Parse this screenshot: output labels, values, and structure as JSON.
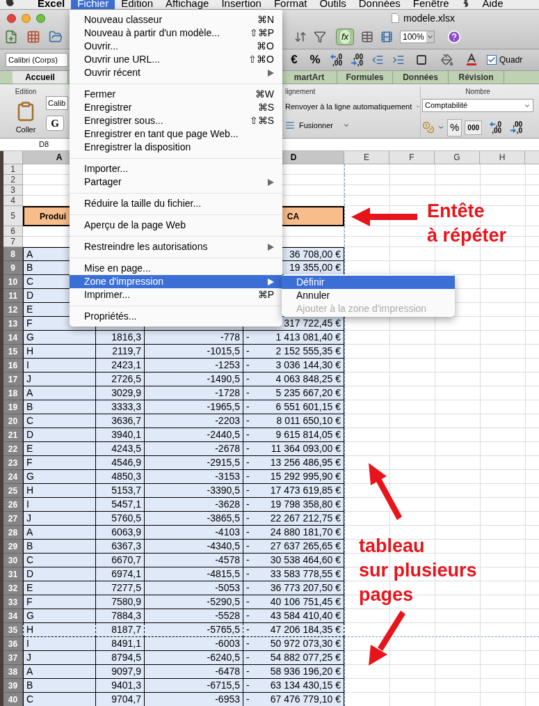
{
  "menu_bar": {
    "items": [
      {
        "kind": "app",
        "label": "Excel",
        "selected": false
      },
      {
        "kind": "menu",
        "label": "Fichier",
        "selected": true
      },
      {
        "kind": "menu",
        "label": "Edition",
        "selected": false
      },
      {
        "kind": "menu",
        "label": "Affichage",
        "selected": false
      },
      {
        "kind": "menu",
        "label": "Insertion",
        "selected": false
      },
      {
        "kind": "menu",
        "label": "Format",
        "selected": false
      },
      {
        "kind": "menu",
        "label": "Outils",
        "selected": false
      },
      {
        "kind": "menu",
        "label": "Données",
        "selected": false
      },
      {
        "kind": "menu",
        "label": "Fenêtre",
        "selected": false
      },
      {
        "kind": "script_icon",
        "selected": false
      },
      {
        "kind": "menu",
        "label": "Aide",
        "selected": false
      }
    ]
  },
  "window": {
    "title": "modele.xlsx"
  },
  "toolbar": {
    "function_label": "fx",
    "zoom": "100%"
  },
  "format_bar": {
    "font": "Calibri (Corps)",
    "buttons": [
      {
        "kind": "text",
        "label": "€"
      },
      {
        "kind": "text",
        "label": "%"
      },
      {
        "kind": "decimal",
        "top": ",0",
        "bottom": ",00"
      },
      {
        "kind": "decimal",
        "top": ",00",
        "bottom": ",0"
      }
    ],
    "checkbox": {
      "label": "Quadr",
      "checked": true
    }
  },
  "ribbon_tabs": [
    {
      "label": "Accueil",
      "selected": true
    },
    {
      "label": "martArt",
      "selected": false
    },
    {
      "label": "Formules",
      "selected": false
    },
    {
      "label": "Données",
      "selected": false
    },
    {
      "label": "Révision",
      "selected": false
    }
  ],
  "ribbon": {
    "edition": {
      "title": "Edition",
      "paste": "Coller"
    },
    "font": {
      "name": "Calib",
      "bold": "G"
    },
    "alignment": {
      "title": "lignement",
      "wrap": "Renvoyer à la ligne automatiquement",
      "merge": "Fusionner"
    },
    "number": {
      "title": "Nombre",
      "format": "Comptabilité",
      "percent": "%",
      "thousands": "000",
      "decimals": [
        {
          "top": ",0",
          "bottom": ",00"
        },
        {
          "top": ",00",
          "bottom": ",0"
        }
      ]
    }
  },
  "formula_bar": {
    "cell": "D8"
  },
  "columns": [
    {
      "label": "A",
      "selected": true
    },
    {
      "label": "D",
      "selected": true
    },
    {
      "label": "E",
      "selected": false
    },
    {
      "label": "F",
      "selected": false
    },
    {
      "label": "G",
      "selected": false
    },
    {
      "label": "H",
      "selected": false
    }
  ],
  "rows": [
    {
      "number": "1",
      "kind": "blank",
      "selected": false
    },
    {
      "number": "2",
      "kind": "blank",
      "selected": false
    },
    {
      "number": "3",
      "kind": "blank",
      "selected": false
    },
    {
      "number": "4",
      "kind": "blank",
      "selected": false
    },
    {
      "number": "5",
      "kind": "header",
      "selected": false,
      "a": "Produi",
      "d": "CA"
    },
    {
      "number": "6",
      "kind": "blank",
      "selected": false
    },
    {
      "number": "7",
      "kind": "blank",
      "selected": false
    },
    {
      "number": "8",
      "kind": "data",
      "selected": true,
      "a": "A",
      "d": "36 708,00 €"
    },
    {
      "number": "9",
      "kind": "data",
      "selected": true,
      "a": "B",
      "d": "19 355,00 €"
    },
    {
      "number": "10",
      "kind": "data",
      "selected": true,
      "a": "C"
    },
    {
      "number": "11",
      "kind": "data",
      "selected": true,
      "a": "D"
    },
    {
      "number": "12",
      "kind": "data",
      "selected": true,
      "a": "E"
    },
    {
      "number": "13",
      "kind": "data",
      "selected": true,
      "a": "F",
      "d": "317 722,45 €"
    },
    {
      "number": "14",
      "kind": "data",
      "selected": true,
      "a": "G",
      "b": "1816,3",
      "c": "-778",
      "d_prefix": "-",
      "d": "1 413 081,40 €"
    },
    {
      "number": "15",
      "kind": "data",
      "selected": true,
      "a": "H",
      "b": "2119,7",
      "c": "-1015,5",
      "d_prefix": "-",
      "d": "2 152 555,35 €"
    },
    {
      "number": "16",
      "kind": "data",
      "selected": true,
      "a": "I",
      "b": "2423,1",
      "c": "-1253",
      "d_prefix": "-",
      "d": "3 036 144,30 €"
    },
    {
      "number": "17",
      "kind": "data",
      "selected": true,
      "a": "J",
      "b": "2726,5",
      "c": "-1490,5",
      "d_prefix": "-",
      "d": "4 063 848,25 €"
    },
    {
      "number": "18",
      "kind": "data",
      "selected": true,
      "a": "A",
      "b": "3029,9",
      "c": "-1728",
      "d_prefix": "-",
      "d": "5 235 667,20 €"
    },
    {
      "number": "19",
      "kind": "data",
      "selected": true,
      "a": "B",
      "b": "3333,3",
      "c": "-1965,5",
      "d_prefix": "-",
      "d": "6 551 601,15 €"
    },
    {
      "number": "20",
      "kind": "data",
      "selected": true,
      "a": "C",
      "b": "3636,7",
      "c": "-2203",
      "d_prefix": "-",
      "d": "8 011 650,10 €"
    },
    {
      "number": "21",
      "kind": "data",
      "selected": true,
      "a": "D",
      "b": "3940,1",
      "c": "-2440,5",
      "d_prefix": "-",
      "d": "9 615 814,05 €"
    },
    {
      "number": "22",
      "kind": "data",
      "selected": true,
      "a": "E",
      "b": "4243,5",
      "c": "-2678",
      "d_prefix": "-",
      "d": "11 364 093,00 €"
    },
    {
      "number": "23",
      "kind": "data",
      "selected": true,
      "a": "F",
      "b": "4546,9",
      "c": "-2915,5",
      "d_prefix": "-",
      "d": "13 256 486,95 €"
    },
    {
      "number": "24",
      "kind": "data",
      "selected": true,
      "a": "G",
      "b": "4850,3",
      "c": "-3153",
      "d_prefix": "-",
      "d": "15 292 995,90 €"
    },
    {
      "number": "25",
      "kind": "data",
      "selected": true,
      "a": "H",
      "b": "5153,7",
      "c": "-3390,5",
      "d_prefix": "-",
      "d": "17 473 619,85 €"
    },
    {
      "number": "26",
      "kind": "data",
      "selected": true,
      "a": "I",
      "b": "5457,1",
      "c": "-3628",
      "d_prefix": "-",
      "d": "19 798 358,80 €"
    },
    {
      "number": "27",
      "kind": "data",
      "selected": true,
      "a": "J",
      "b": "5760,5",
      "c": "-3865,5",
      "d_prefix": "-",
      "d": "22 267 212,75 €"
    },
    {
      "number": "28",
      "kind": "data",
      "selected": true,
      "a": "A",
      "b": "6063,9",
      "c": "-4103",
      "d_prefix": "-",
      "d": "24 880 181,70 €"
    },
    {
      "number": "29",
      "kind": "data",
      "selected": true,
      "a": "B",
      "b": "6367,3",
      "c": "-4340,5",
      "d_prefix": "-",
      "d": "27 637 265,65 €"
    },
    {
      "number": "30",
      "kind": "data",
      "selected": true,
      "a": "C",
      "b": "6670,7",
      "c": "-4578",
      "d_prefix": "-",
      "d": "30 538 464,60 €"
    },
    {
      "number": "31",
      "kind": "data",
      "selected": true,
      "a": "D",
      "b": "6974,1",
      "c": "-4815,5",
      "d_prefix": "-",
      "d": "33 583 778,55 €"
    },
    {
      "number": "32",
      "kind": "data",
      "selected": true,
      "a": "E",
      "b": "7277,5",
      "c": "-5053",
      "d_prefix": "-",
      "d": "36 773 207,50 €"
    },
    {
      "number": "33",
      "kind": "data",
      "selected": true,
      "a": "F",
      "b": "7580,9",
      "c": "-5290,5",
      "d_prefix": "-",
      "d": "40 106 751,45 €"
    },
    {
      "number": "34",
      "kind": "data",
      "selected": true,
      "a": "G",
      "b": "7884,3",
      "c": "-5528",
      "d_prefix": "-",
      "d": "43 584 410,40 €"
    },
    {
      "number": "35",
      "kind": "data",
      "selected": true,
      "a": "H",
      "b": "8187,7",
      "c": "-5765,5",
      "d_prefix": "-",
      "d": "47 206 184,35 €",
      "page_break": true
    },
    {
      "number": "36",
      "kind": "data",
      "selected": true,
      "a": "I",
      "b": "8491,1",
      "c": "-6003",
      "d_prefix": "-",
      "d": "50 972 073,30 €"
    },
    {
      "number": "37",
      "kind": "data",
      "selected": true,
      "a": "J",
      "b": "8794,5",
      "c": "-6240,5",
      "d_prefix": "-",
      "d": "54 882 077,25 €"
    },
    {
      "number": "38",
      "kind": "data",
      "selected": true,
      "a": "A",
      "b": "9097,9",
      "c": "-6478",
      "d_prefix": "-",
      "d": "58 936 196,20 €"
    },
    {
      "number": "39",
      "kind": "data",
      "selected": true,
      "a": "B",
      "b": "9401,3",
      "c": "-6715,5",
      "d_prefix": "-",
      "d": "63 134 430,15 €"
    },
    {
      "number": "40",
      "kind": "data",
      "selected": true,
      "a": "C",
      "b": "9704,7",
      "c": "-6953",
      "d_prefix": "-",
      "d": "67 476 779,10 €"
    }
  ],
  "file_menu": {
    "sections": [
      [
        {
          "label": "Nouveau classeur",
          "shortcut": "⌘N",
          "submenu": false,
          "selected": false
        },
        {
          "label": "Nouveau à partir d'un modèle...",
          "shortcut": "⇧⌘P",
          "submenu": false,
          "selected": false
        },
        {
          "label": "Ouvrir...",
          "shortcut": "⌘O",
          "submenu": false,
          "selected": false
        },
        {
          "label": "Ouvrir une URL...",
          "shortcut": "⇧⌘O",
          "submenu": false,
          "selected": false
        },
        {
          "label": "Ouvrir récent",
          "submenu": true,
          "selected": false
        }
      ],
      [
        {
          "label": "Fermer",
          "shortcut": "⌘W",
          "submenu": false,
          "selected": false
        },
        {
          "label": "Enregistrer",
          "shortcut": "⌘S",
          "submenu": false,
          "selected": false
        },
        {
          "label": "Enregistrer sous...",
          "shortcut": "⇧⌘S",
          "submenu": false,
          "selected": false
        },
        {
          "label": "Enregistrer en tant que page Web...",
          "submenu": false,
          "selected": false
        },
        {
          "label": "Enregistrer la disposition",
          "submenu": false,
          "selected": false
        }
      ],
      [
        {
          "label": "Importer...",
          "submenu": false,
          "selected": false
        },
        {
          "label": "Partager",
          "submenu": true,
          "selected": false
        }
      ],
      [
        {
          "label": "Réduire la taille du fichier...",
          "submenu": false,
          "selected": false
        }
      ],
      [
        {
          "label": "Aperçu de la page Web",
          "submenu": false,
          "selected": false
        }
      ],
      [
        {
          "label": "Restreindre les autorisations",
          "submenu": true,
          "selected": false
        }
      ],
      [
        {
          "label": "Mise en page...",
          "submenu": false,
          "selected": false
        },
        {
          "label": "Zone d'impression",
          "submenu": true,
          "selected": true
        },
        {
          "label": "Imprimer...",
          "shortcut": "⌘P",
          "submenu": false,
          "selected": false
        }
      ],
      [
        {
          "label": "Propriétés...",
          "submenu": false,
          "selected": false
        }
      ]
    ]
  },
  "submenu": {
    "items": [
      {
        "label": "Définir",
        "selected": true,
        "disabled": false
      },
      {
        "label": "Annuler",
        "selected": false,
        "disabled": false
      },
      {
        "label": "Ajouter à la zone d'impression",
        "selected": false,
        "disabled": true
      }
    ]
  },
  "annotations": [
    {
      "kind": "header",
      "lines": [
        "Entête",
        "à répéter"
      ]
    },
    {
      "kind": "table",
      "lines": [
        "tableau",
        "sur plusieurs",
        "pages"
      ]
    }
  ]
}
